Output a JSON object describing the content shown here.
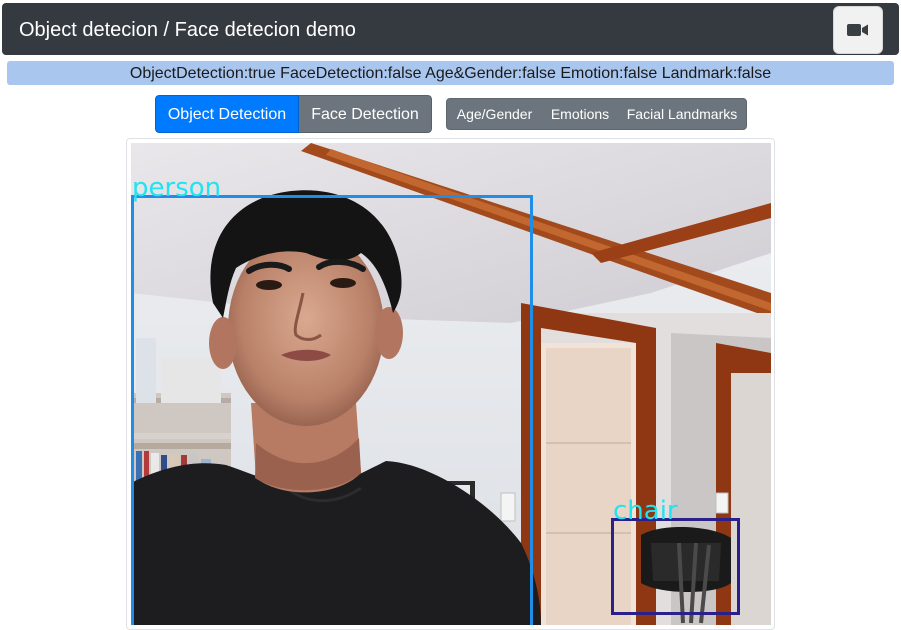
{
  "navbar": {
    "title": "Object detecion / Face detecion demo",
    "camera_icon": "video-camera-icon"
  },
  "status": {
    "text": "ObjectDetection:true FaceDetection:false Age&Gender:false Emotion:false Landmark:false"
  },
  "mode_buttons": {
    "object_detection": "Object Detection",
    "face_detection": "Face Detection"
  },
  "feature_buttons": {
    "age_gender": "Age/Gender",
    "emotions": "Emotions",
    "facial_landmarks": "Facial Landmarks"
  },
  "detections": {
    "person": "person",
    "chair": "chair"
  },
  "colors": {
    "navbar": "#343a40",
    "primary": "#007bff",
    "secondary": "#6c757d",
    "status_bg": "#a9c6ee",
    "person_box": "#1f8ee8",
    "chair_box": "#2b1f8a",
    "label_text": "#22e3f0"
  }
}
